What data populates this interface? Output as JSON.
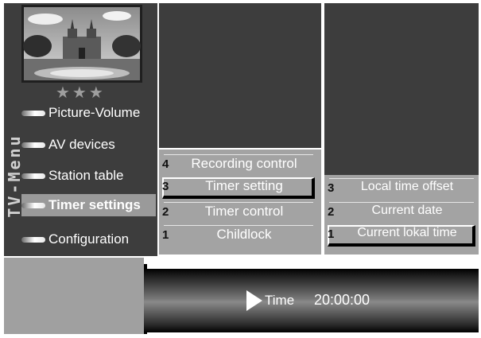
{
  "menu": {
    "vertical_title": "TV-Menu",
    "items": [
      {
        "label": "Picture-Volume"
      },
      {
        "label": "AV devices"
      },
      {
        "label": "Station table"
      },
      {
        "label": "Timer settings"
      },
      {
        "label": "Configuration"
      }
    ],
    "selected_index": 3,
    "rating_stars": "★★★"
  },
  "timer_submenu": {
    "items": [
      {
        "num": "4",
        "label": "Recording control"
      },
      {
        "num": "3",
        "label": "Timer setting"
      },
      {
        "num": "2",
        "label": "Timer control"
      },
      {
        "num": "1",
        "label": "Childlock"
      }
    ],
    "highlighted_index": 1
  },
  "time_submenu": {
    "items": [
      {
        "num": "3",
        "label": "Local time offset"
      },
      {
        "num": "2",
        "label": "Current date"
      },
      {
        "num": "1",
        "label": "Current lokal time"
      }
    ],
    "highlighted_index": 2
  },
  "status": {
    "time_label": "Time",
    "time_value": "20:00:00"
  },
  "colors": {
    "panel_dark": "#3d3d3d",
    "panel_gray": "#a3a3a3",
    "highlight_border": "#ffffff",
    "text": "#ffffff"
  }
}
